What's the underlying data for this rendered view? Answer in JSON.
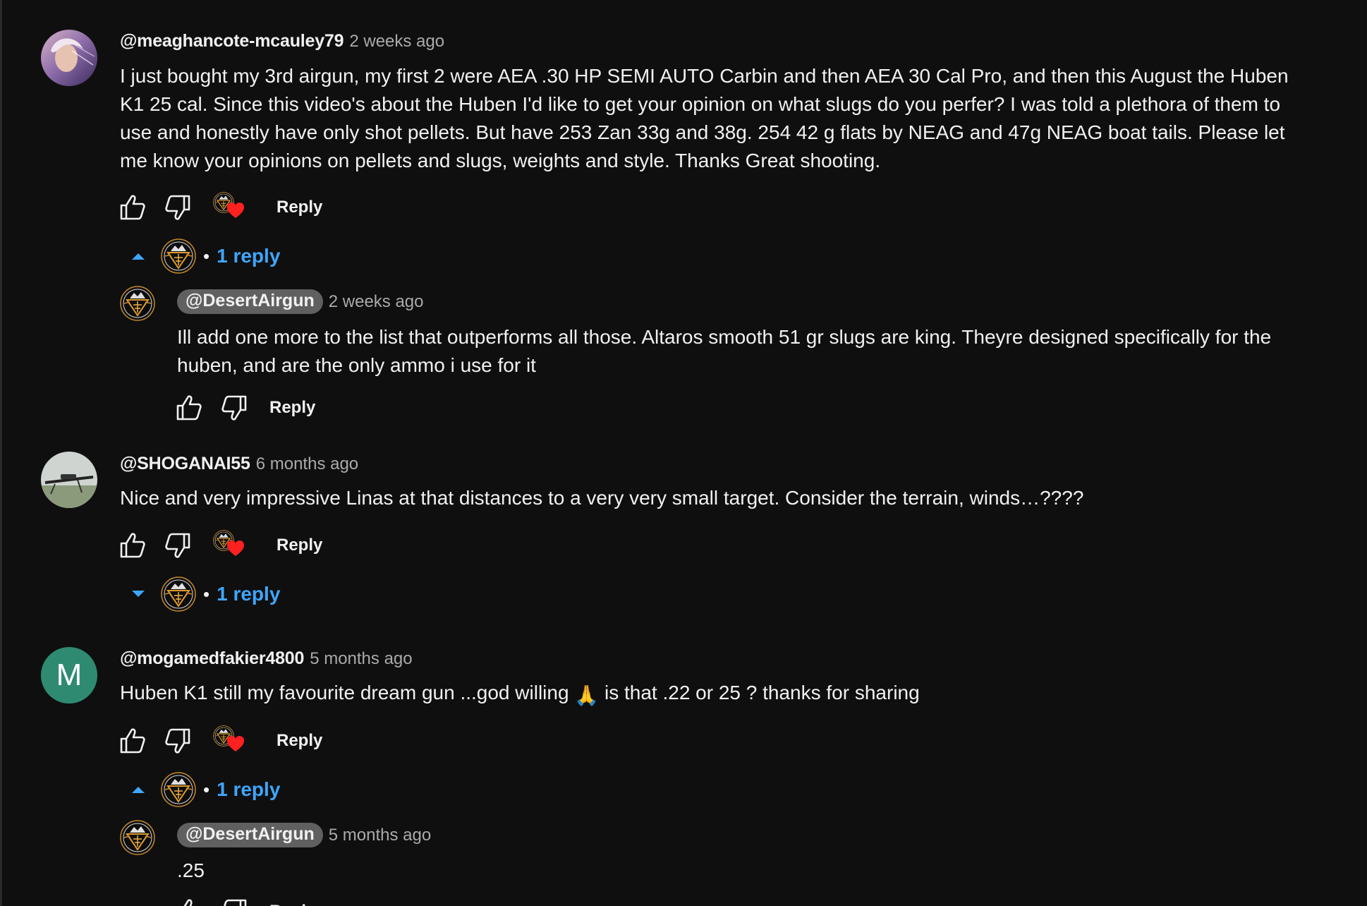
{
  "comments": [
    {
      "author": "@meaghancote-mcauley79",
      "time": "2 weeks ago",
      "text": "I just bought my 3rd airgun, my first 2 were AEA .30 HP SEMI AUTO Carbin and then AEA 30 Cal Pro, and then this August the Huben K1 25 cal. Since this video's about the Huben I'd like to get your opinion on what slugs do you perfer? I was told a plethora of them to use and honestly have only shot pellets.  But have 253 Zan 33g and 38g. 254 42 g flats by NEAG and 47g NEAG boat tails. Please let me know your opinions on pellets and slugs, weights and style.  Thanks Great shooting.",
      "reply_label": "Reply",
      "replies_toggle": "1 reply",
      "replies_expanded": true,
      "reply": {
        "author": "@DesertAirgun",
        "time": "2 weeks ago",
        "text": "Ill add one more to the list that outperforms all those. Altaros smooth 51 gr slugs are king. Theyre designed specifically for the huben, and are the only ammo i use for it",
        "reply_label": "Reply"
      }
    },
    {
      "author": "@SHOGANAI55",
      "time": "6 months ago",
      "text": "Nice and very impressive Linas at that distances to a very very small target.  Consider the terrain, winds…????",
      "reply_label": "Reply",
      "replies_toggle": "1 reply",
      "replies_expanded": false
    },
    {
      "author": "@mogamedfakier4800",
      "avatar_letter": "M",
      "time": "5 months ago",
      "text_before_emoji": "Huben K1 still my favourite dream gun ...god willing ",
      "emoji": "🙏",
      "text_after_emoji": " is that .22 or 25 ? thanks for sharing",
      "reply_label": "Reply",
      "replies_toggle": "1 reply",
      "replies_expanded": true,
      "reply": {
        "author": "@DesertAirgun",
        "time": "5 months ago",
        "text": ".25",
        "reply_label": "Reply"
      }
    }
  ],
  "colors": {
    "background": "#0f0f0f",
    "text": "#f1f1f1",
    "secondary_text": "#aaaaaa",
    "link_blue": "#3ea6ff",
    "heart_red": "#ff0000",
    "author_chip": "#606060",
    "letter_avatar": "#2e8b72"
  },
  "icons": {
    "like": "thumbs-up-icon",
    "dislike": "thumbs-down-icon",
    "creator_heart": "heart-icon",
    "expand": "chevron-down-icon",
    "collapse": "chevron-up-icon"
  }
}
